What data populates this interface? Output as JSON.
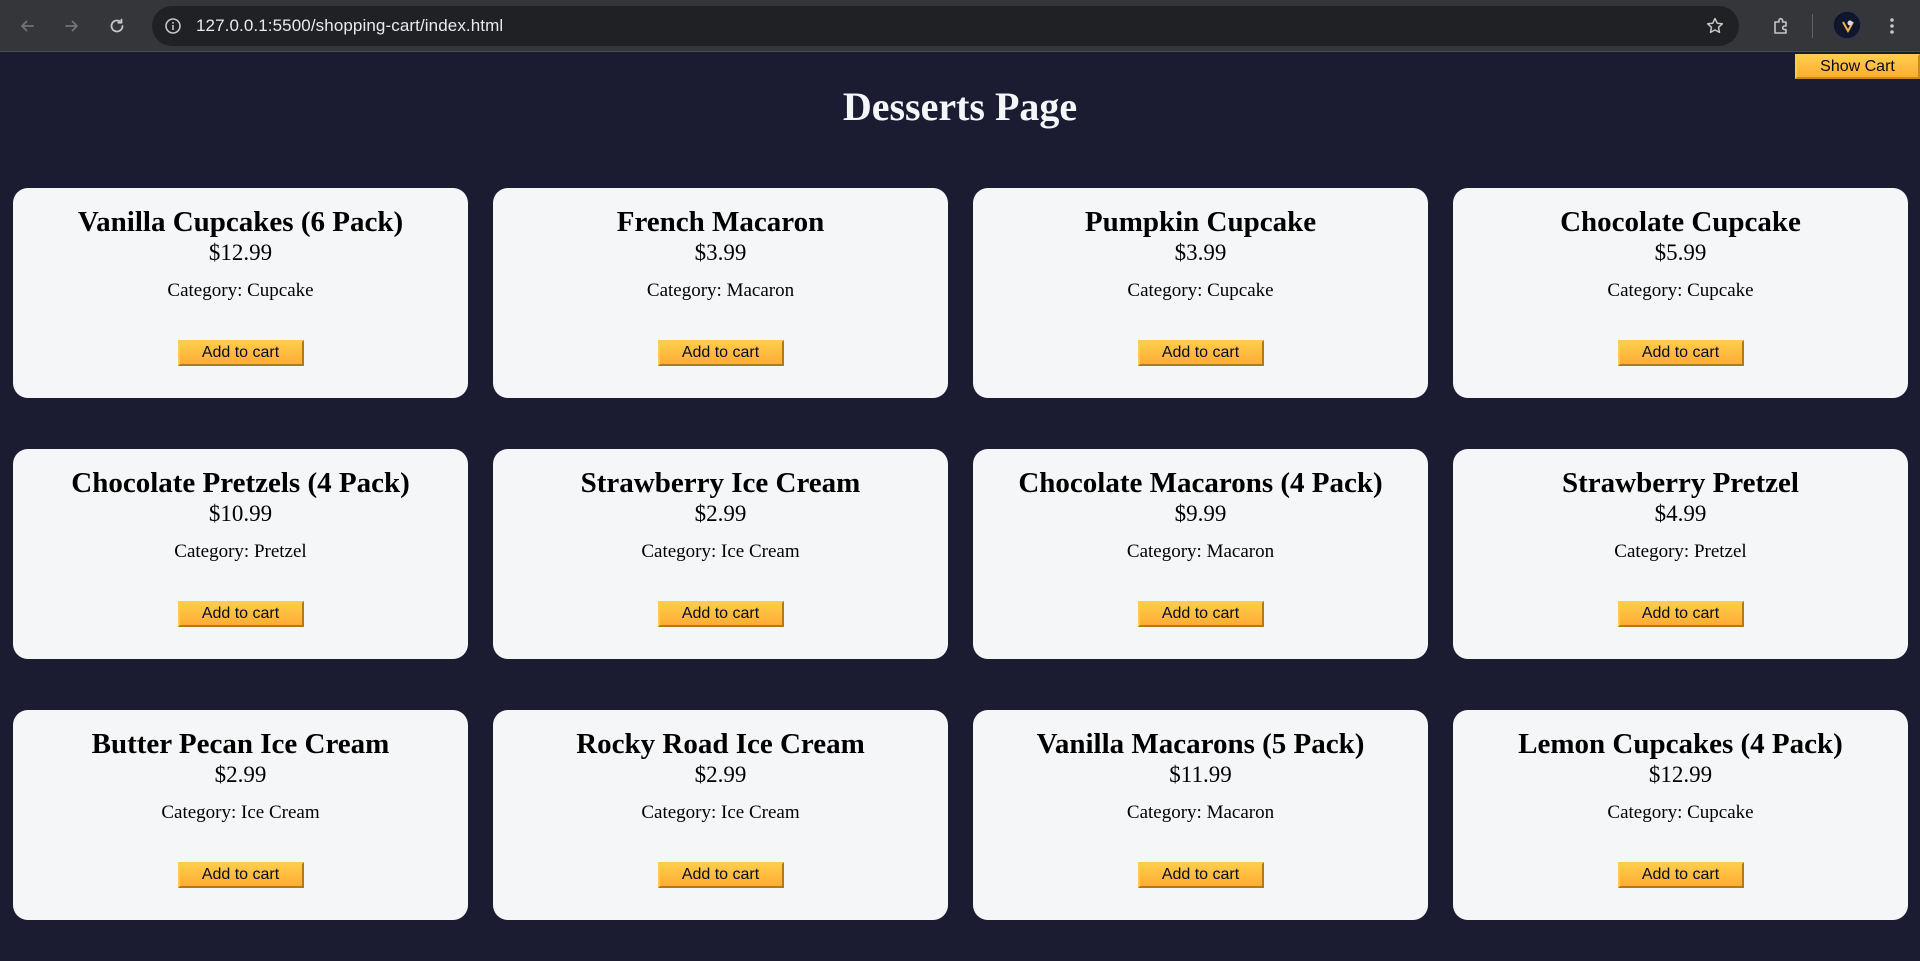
{
  "browser": {
    "url": "127.0.0.1:5500/shopping-cart/index.html",
    "icons": [
      "back-arrow-icon",
      "forward-arrow-icon",
      "reload-icon",
      "site-info-icon",
      "bookmark-star-icon",
      "extensions-icon",
      "profile-avatar",
      "kebab-menu-icon"
    ]
  },
  "header": {
    "show_cart_label": "Show Cart",
    "title": "Desserts Page"
  },
  "colors": {
    "page_background": "#1b1b32",
    "card_background": "#f5f6f7",
    "button_accent": "#feac32"
  },
  "products": [
    {
      "name": "Vanilla Cupcakes (6 Pack)",
      "price": "$12.99",
      "category": "Category: Cupcake",
      "button": "Add to cart"
    },
    {
      "name": "French Macaron",
      "price": "$3.99",
      "category": "Category: Macaron",
      "button": "Add to cart"
    },
    {
      "name": "Pumpkin Cupcake",
      "price": "$3.99",
      "category": "Category: Cupcake",
      "button": "Add to cart"
    },
    {
      "name": "Chocolate Cupcake",
      "price": "$5.99",
      "category": "Category: Cupcake",
      "button": "Add to cart"
    },
    {
      "name": "Chocolate Pretzels (4 Pack)",
      "price": "$10.99",
      "category": "Category: Pretzel",
      "button": "Add to cart"
    },
    {
      "name": "Strawberry Ice Cream",
      "price": "$2.99",
      "category": "Category: Ice Cream",
      "button": "Add to cart"
    },
    {
      "name": "Chocolate Macarons (4 Pack)",
      "price": "$9.99",
      "category": "Category: Macaron",
      "button": "Add to cart"
    },
    {
      "name": "Strawberry Pretzel",
      "price": "$4.99",
      "category": "Category: Pretzel",
      "button": "Add to cart"
    },
    {
      "name": "Butter Pecan Ice Cream",
      "price": "$2.99",
      "category": "Category: Ice Cream",
      "button": "Add to cart"
    },
    {
      "name": "Rocky Road Ice Cream",
      "price": "$2.99",
      "category": "Category: Ice Cream",
      "button": "Add to cart"
    },
    {
      "name": "Vanilla Macarons (5 Pack)",
      "price": "$11.99",
      "category": "Category: Macaron",
      "button": "Add to cart"
    },
    {
      "name": "Lemon Cupcakes (4 Pack)",
      "price": "$12.99",
      "category": "Category: Cupcake",
      "button": "Add to cart"
    }
  ]
}
